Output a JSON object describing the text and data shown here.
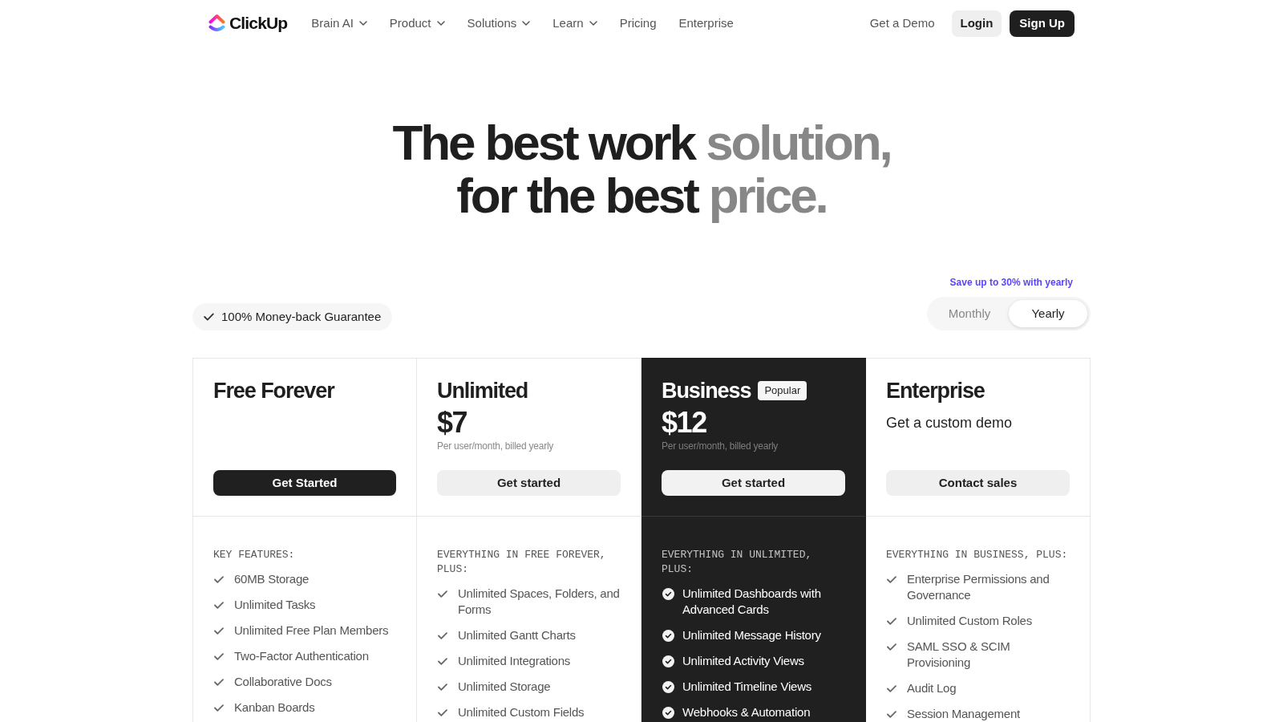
{
  "nav": {
    "logo": "ClickUp",
    "links": [
      {
        "label": "Brain AI",
        "dropdown": true
      },
      {
        "label": "Product",
        "dropdown": true
      },
      {
        "label": "Solutions",
        "dropdown": true
      },
      {
        "label": "Learn",
        "dropdown": true
      },
      {
        "label": "Pricing",
        "dropdown": false
      },
      {
        "label": "Enterprise",
        "dropdown": false
      }
    ],
    "actions": [
      {
        "label": "Get a Demo",
        "kind": "link"
      },
      {
        "label": "Login",
        "kind": "secondary"
      },
      {
        "label": "Sign Up",
        "kind": "primary"
      }
    ]
  },
  "hero": {
    "lines": [
      [
        {
          "text": "The best work",
          "muted": false
        },
        {
          "text": "solution,",
          "muted": true
        }
      ],
      [
        {
          "text": "for the best",
          "muted": false
        },
        {
          "text": "price.",
          "muted": true
        }
      ]
    ]
  },
  "pricing_controls": {
    "guarantee": "100% Money-back Guarantee",
    "savings_note": "Save up to 30% with yearly",
    "billing_toggle": [
      {
        "label": "Monthly",
        "selected": false
      },
      {
        "label": "Yearly",
        "selected": true
      }
    ]
  },
  "plans": [
    {
      "kind": "standard",
      "name": "Free Forever",
      "cta": {
        "label": "Get Started",
        "kind": "solid"
      },
      "features_heading": "KEY FEATURES:",
      "features": [
        "60MB Storage",
        "Unlimited Tasks",
        "Unlimited Free Plan Members",
        "Two-Factor Authentication",
        "Collaborative Docs",
        "Kanban Boards"
      ]
    },
    {
      "kind": "standard",
      "name": "Unlimited",
      "price": "$7",
      "price_note": "Per user/month, billed yearly",
      "cta": {
        "label": "Get started",
        "kind": "soft"
      },
      "features_heading": "EVERYTHING IN FREE FOREVER, PLUS:",
      "features": [
        "Unlimited Spaces, Folders, and Forms",
        "Unlimited Gantt Charts",
        "Unlimited Integrations",
        "Unlimited Storage",
        "Unlimited Custom Fields"
      ]
    },
    {
      "kind": "featured",
      "name": "Business",
      "badge": "Popular",
      "price": "$12",
      "price_note": "Per user/month, billed yearly",
      "cta": {
        "label": "Get started",
        "kind": "soft"
      },
      "features_heading": "EVERYTHING IN UNLIMITED, PLUS:",
      "features": [
        "Unlimited Dashboards with Advanced Cards",
        "Unlimited Message History",
        "Unlimited Activity Views",
        "Unlimited Timeline Views",
        "Webhooks & Automation"
      ]
    },
    {
      "kind": "standard",
      "name": "Enterprise",
      "tagline": "Get a custom demo",
      "cta": {
        "label": "Contact sales",
        "kind": "soft"
      },
      "features_heading": "EVERYTHING IN BUSINESS, PLUS:",
      "features": [
        "Enterprise Permissions and Governance",
        "Unlimited Custom Roles",
        "SAML SSO & SCIM Provisioning",
        "Audit Log",
        "Session Management"
      ]
    }
  ]
}
